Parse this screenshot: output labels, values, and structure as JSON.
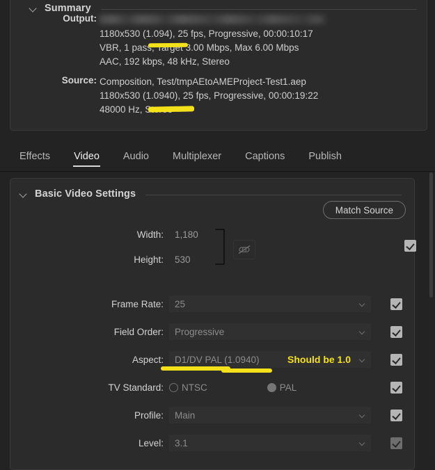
{
  "summary": {
    "section_title": "Summary",
    "output_label": "Output:",
    "output_path_redacted": "",
    "output_lines": [
      "1180x530 (1.094), 25 fps, Progressive, 00:00:10:17",
      "VBR, 1 pass, Target 3.00 Mbps, Max 6.00 Mbps",
      "AAC, 192 kbps, 48 kHz, Stereo"
    ],
    "source_label": "Source:",
    "source_lines": [
      "Composition, Test/tmpAEtoAMEProject-Test1.aep",
      "1180x530 (1.0940), 25 fps, Progressive, 00:00:19:22",
      "48000 Hz, Stereo"
    ]
  },
  "tabs": [
    {
      "label": "Effects",
      "active": false
    },
    {
      "label": "Video",
      "active": true
    },
    {
      "label": "Audio",
      "active": false
    },
    {
      "label": "Multiplexer",
      "active": false
    },
    {
      "label": "Captions",
      "active": false
    },
    {
      "label": "Publish",
      "active": false
    }
  ],
  "basic_video": {
    "section_title": "Basic Video Settings",
    "match_source_label": "Match Source",
    "fields": {
      "width": {
        "label": "Width:",
        "value": "1,180"
      },
      "height": {
        "label": "Height:",
        "value": "530"
      },
      "frame_rate": {
        "label": "Frame Rate:",
        "value": "25"
      },
      "field_order": {
        "label": "Field Order:",
        "value": "Progressive"
      },
      "aspect": {
        "label": "Aspect:",
        "value": "D1/DV PAL (1.0940)"
      },
      "tv_standard": {
        "label": "TV Standard:",
        "options": [
          {
            "label": "NTSC",
            "selected": false
          },
          {
            "label": "PAL",
            "selected": true
          }
        ]
      },
      "profile": {
        "label": "Profile:",
        "value": "Main"
      },
      "level": {
        "label": "Level:",
        "value": "3.1"
      }
    },
    "link_icon": "broken-chain-icon"
  },
  "annotations": {
    "aspect_note": "Should be 1.0",
    "marker_color": "#f5e119"
  },
  "theme": {
    "bg": "#232323",
    "panel_bg": "#2b2b2b",
    "field_bg": "#303030",
    "text": "#d3d3d3",
    "muted_text": "#8c8c8c",
    "accent_yellow": "#f5e119"
  }
}
